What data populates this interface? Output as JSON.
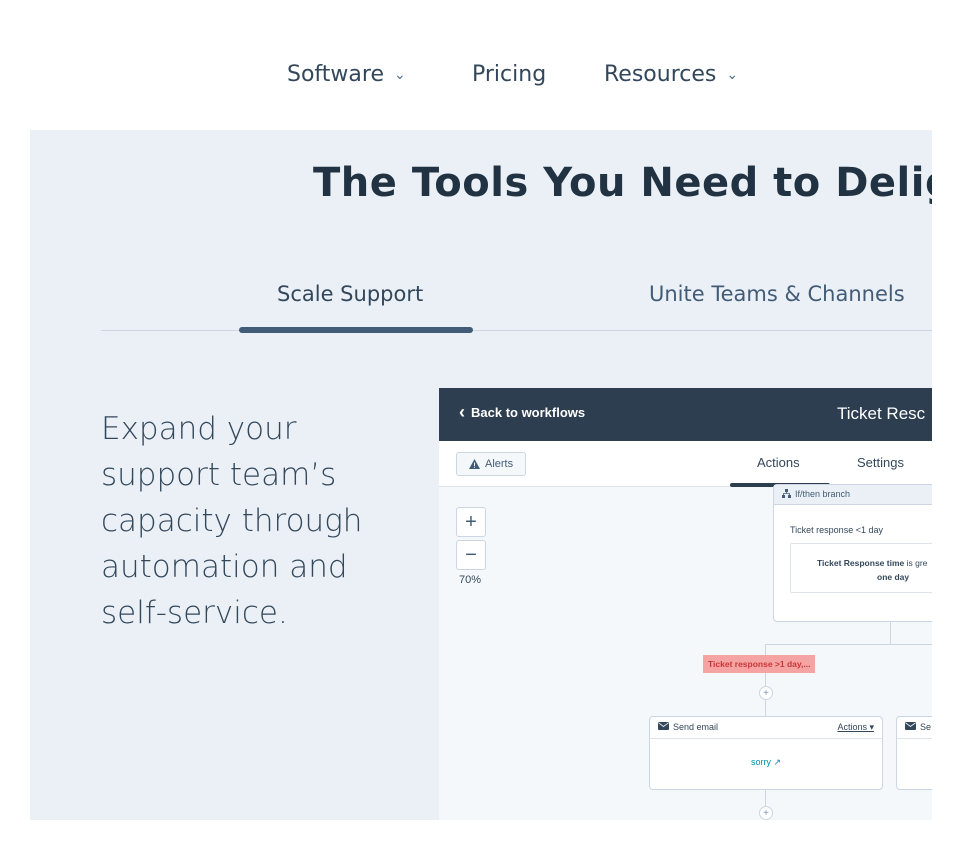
{
  "nav": {
    "items": [
      {
        "label": "Software",
        "has_dropdown": true
      },
      {
        "label": "Pricing",
        "has_dropdown": false
      },
      {
        "label": "Resources",
        "has_dropdown": true
      }
    ],
    "dropdown_glyph": "⌄"
  },
  "section": {
    "headline": "The Tools You Need to Deligh",
    "tabs": [
      {
        "label": "Scale Support",
        "active": true
      },
      {
        "label": "Unite Teams & Channels",
        "active": false
      }
    ],
    "lead": "Expand your support team’s capacity through automation and self-service."
  },
  "workflow": {
    "back_label": "Back to workflows",
    "title": "Ticket Resc",
    "alerts_label": "Alerts",
    "tabs": [
      {
        "label": "Actions",
        "active": true
      },
      {
        "label": "Settings",
        "active": false
      }
    ],
    "zoom_in": "+",
    "zoom_out": "−",
    "zoom_level": "70%",
    "branch": {
      "header": "If/then branch",
      "condition": "Ticket response <1 day",
      "rule_bold": "Ticket Response time",
      "rule_rest": " is gre",
      "rule_line2": "one day"
    },
    "branch_label": "Ticket response >1 day,...",
    "add_glyph": "+",
    "email_cards": [
      {
        "header": "Send email",
        "actions": "Actions ▾",
        "body": "sorry ↗"
      },
      {
        "header": "Se",
        "actions": "",
        "body": ""
      }
    ]
  },
  "colors": {
    "section_bg": "#eaf0f6",
    "app_bar": "#2d3e50",
    "tab_underline": "#425b76",
    "branch_label_bg": "#f5a3a3",
    "link": "#0091ae"
  },
  "icons": {
    "back": "chevron-left-icon",
    "alerts": "warning-icon",
    "branch": "branch-icon",
    "email": "envelope-icon"
  }
}
